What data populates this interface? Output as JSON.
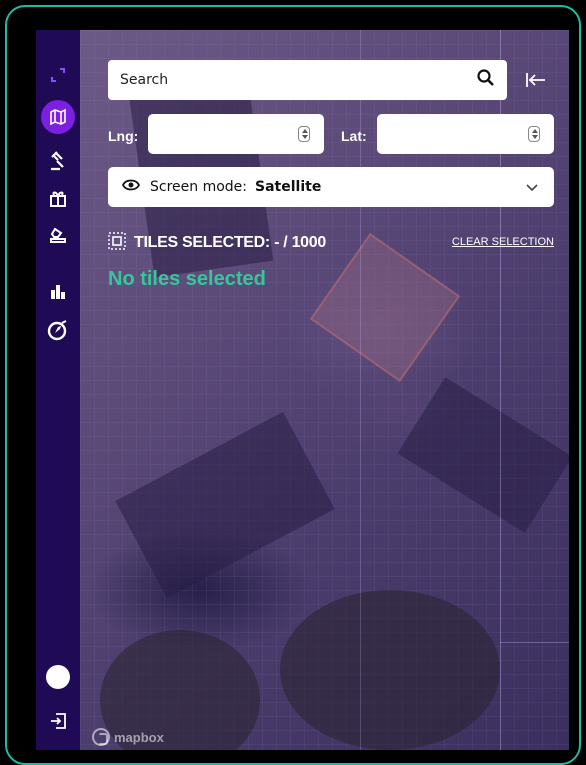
{
  "sidebar": {
    "items": [
      {
        "icon": "expand-icon"
      },
      {
        "icon": "map-icon",
        "active": true
      },
      {
        "icon": "gavel-icon"
      },
      {
        "icon": "gift-icon"
      },
      {
        "icon": "stamp-icon"
      },
      {
        "icon": "bar-chart-icon"
      },
      {
        "icon": "compass-icon"
      }
    ],
    "bottom": [
      {
        "icon": "theme-toggle-icon"
      },
      {
        "icon": "logout-icon"
      }
    ]
  },
  "search": {
    "placeholder": "Search"
  },
  "coords": {
    "lng_label": "Lng:",
    "lat_label": "Lat:",
    "lng_value": "",
    "lat_value": ""
  },
  "screen_mode": {
    "label": "Screen mode:",
    "value": "Satellite"
  },
  "tiles": {
    "title": "TILES SELECTED: - / 1000",
    "clear_label": "CLEAR SELECTION",
    "empty_message": "No tiles selected"
  },
  "attribution": {
    "text": "mapbox"
  },
  "colors": {
    "sidebar": "#1f0b55",
    "accent": "#7b1fe0",
    "success": "#35c79a",
    "frame": "#1fb9a6"
  }
}
